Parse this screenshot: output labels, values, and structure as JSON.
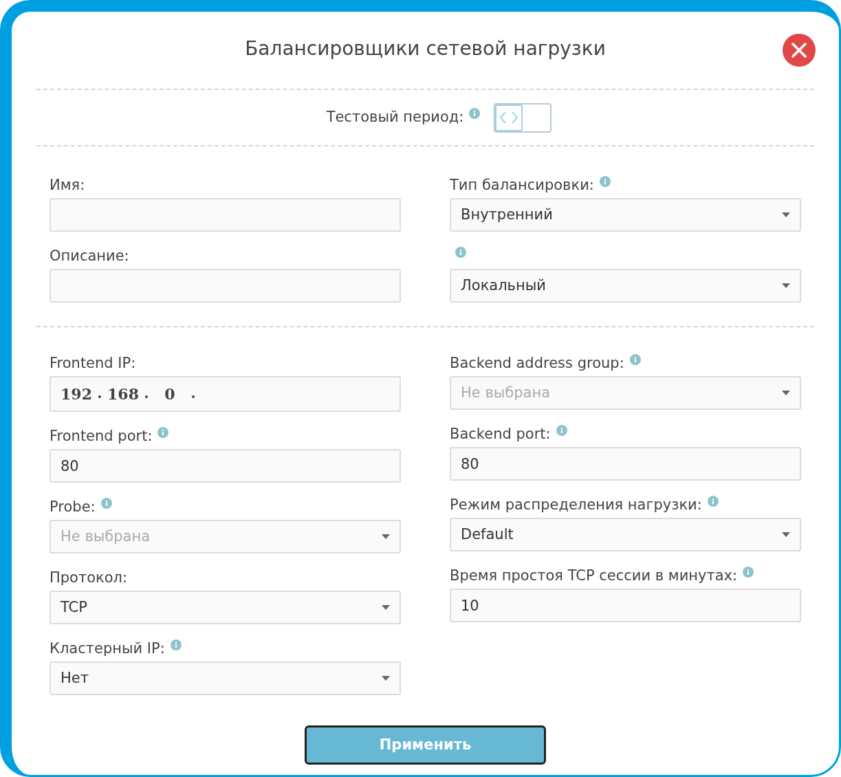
{
  "dialog": {
    "title": "Балансировщики сетевой нагрузки"
  },
  "test_period": {
    "label": "Тестовый период:",
    "info": true,
    "on": false
  },
  "general": {
    "left": [
      {
        "kind": "input",
        "label": "Имя:",
        "info": false
      },
      {
        "kind": "input",
        "label": "Описание:",
        "info": false
      }
    ],
    "right": [
      {
        "kind": "select",
        "label": "Тип балансировки:",
        "info": true,
        "value": "Внутренний"
      },
      {
        "kind": "select",
        "info": true,
        "value": "Локальный"
      }
    ]
  },
  "network": {
    "left": [
      {
        "kind": "ip",
        "label": "Frontend IP:",
        "info": false,
        "octets": [
          "192",
          "168",
          "0"
        ]
      },
      {
        "kind": "input",
        "label": "Frontend port:",
        "info": true,
        "value": "80"
      },
      {
        "kind": "select",
        "label": "Probe:",
        "info": true,
        "placeholder": "Не выбрана"
      },
      {
        "kind": "select",
        "label": "Протокол:",
        "info": false,
        "value": "TCP"
      },
      {
        "kind": "select",
        "label": "Кластерный IP:",
        "info": true,
        "value": "Нет"
      }
    ],
    "right": [
      {
        "kind": "select",
        "label": "Backend address group:",
        "info": true,
        "placeholder": "Не выбрана"
      },
      {
        "kind": "input",
        "label": "Backend port:",
        "info": true,
        "value": "80"
      },
      {
        "kind": "select",
        "label": "Режим распределения нагрузки:",
        "info": true,
        "value": "Default"
      },
      {
        "kind": "input",
        "label": "Время простоя TCP сессии в минутах:",
        "info": true,
        "value": "10"
      }
    ]
  },
  "apply_button": "Применить"
}
